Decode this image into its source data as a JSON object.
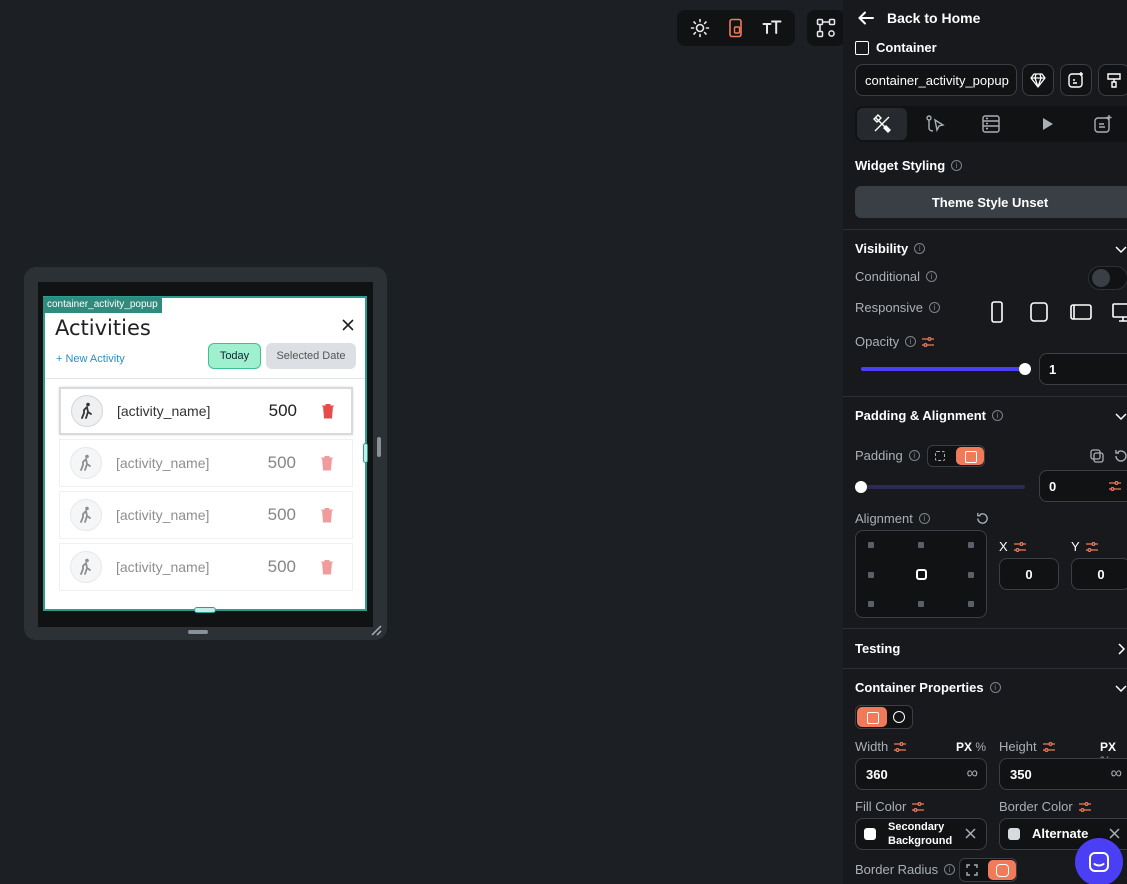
{
  "toolbar": {
    "icons": [
      "sun-icon",
      "mobile-layout-icon",
      "text-size-icon",
      "widget-tree-icon"
    ]
  },
  "canvas": {
    "widget_tag": "container_activity_popup",
    "popup": {
      "title": "Activities",
      "new_activity": "+ New Activity",
      "today_label": "Today",
      "selected_date_label": "Selected Date",
      "rows": [
        {
          "name": "[activity_name]",
          "value": "500"
        },
        {
          "name": "[activity_name]",
          "value": "500"
        },
        {
          "name": "[activity_name]",
          "value": "500"
        },
        {
          "name": "[activity_name]",
          "value": "500"
        }
      ]
    }
  },
  "panel": {
    "back_label": "Back to Home",
    "widget_type": "Container",
    "widget_name": "container_activity_popup",
    "widget_styling_label": "Widget Styling",
    "theme_style": "Theme Style Unset",
    "visibility": {
      "label": "Visibility",
      "conditional_label": "Conditional",
      "responsive_label": "Responsive",
      "opacity_label": "Opacity",
      "opacity_value": "1",
      "opacity_fraction": 1
    },
    "padding_alignment": {
      "label": "Padding & Alignment",
      "padding_label": "Padding",
      "padding_value": "0",
      "alignment_label": "Alignment",
      "x_label": "X",
      "y_label": "Y",
      "x_value": "0",
      "y_value": "0"
    },
    "testing_label": "Testing",
    "container_properties": {
      "label": "Container Properties",
      "width_label": "Width",
      "height_label": "Height",
      "unit_px": "PX",
      "unit_pct": "%",
      "width_value": "360",
      "height_value": "350",
      "infinity": "∞",
      "fill_color_label": "Fill Color",
      "border_color_label": "Border Color",
      "fill_color_line1": "Secondary",
      "fill_color_line2": "Background",
      "border_color_value": "Alternate",
      "border_radius_label": "Border Radius"
    }
  },
  "colors": {
    "accent": "#f07a5a",
    "primary": "#4b3ff5",
    "teal": "#2a9d8f",
    "delete": "#e74c4c"
  }
}
